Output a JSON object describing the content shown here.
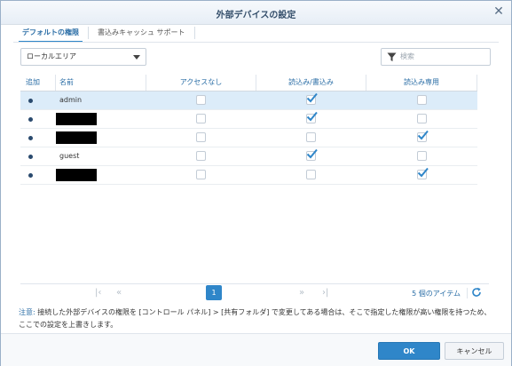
{
  "dialog": {
    "title": "外部デバイスの設定"
  },
  "tabs": [
    {
      "label": "デフォルトの権限",
      "active": true
    },
    {
      "label": "書込みキャッシュ サポート",
      "active": false
    }
  ],
  "filter": {
    "selected": "ローカルエリア"
  },
  "search": {
    "placeholder": "検索"
  },
  "table": {
    "headers": {
      "add": "追加",
      "name": "名前",
      "no_access": "アクセスなし",
      "read_write": "読込み/書込み",
      "read_only": "読込み専用"
    },
    "rows": [
      {
        "name": "admin",
        "redacted": false,
        "no_access": false,
        "read_write": true,
        "read_only": false,
        "selected": true
      },
      {
        "name": "",
        "redacted": true,
        "no_access": false,
        "read_write": true,
        "read_only": false,
        "selected": false
      },
      {
        "name": "",
        "redacted": true,
        "no_access": false,
        "read_write": false,
        "read_only": true,
        "selected": false
      },
      {
        "name": "guest",
        "redacted": false,
        "no_access": false,
        "read_write": true,
        "read_only": false,
        "selected": false
      },
      {
        "name": "",
        "redacted": true,
        "no_access": false,
        "read_write": false,
        "read_only": true,
        "selected": false
      }
    ]
  },
  "pager": {
    "current_page": "1",
    "count_text": "5 個のアイテム"
  },
  "note": {
    "label": "注意:",
    "text": " 接続した外部デバイスの権限を [コントロール パネル] > [共有フォルダ] で変更してある場合は、そこで指定した権限が高い権限を持つため、ここでの設定を上書きします。"
  },
  "buttons": {
    "ok": "OK",
    "cancel": "キャンセル"
  },
  "colors": {
    "accent": "#2f86c9",
    "selected_row": "#dcecf9",
    "check": "#2f86c9"
  }
}
